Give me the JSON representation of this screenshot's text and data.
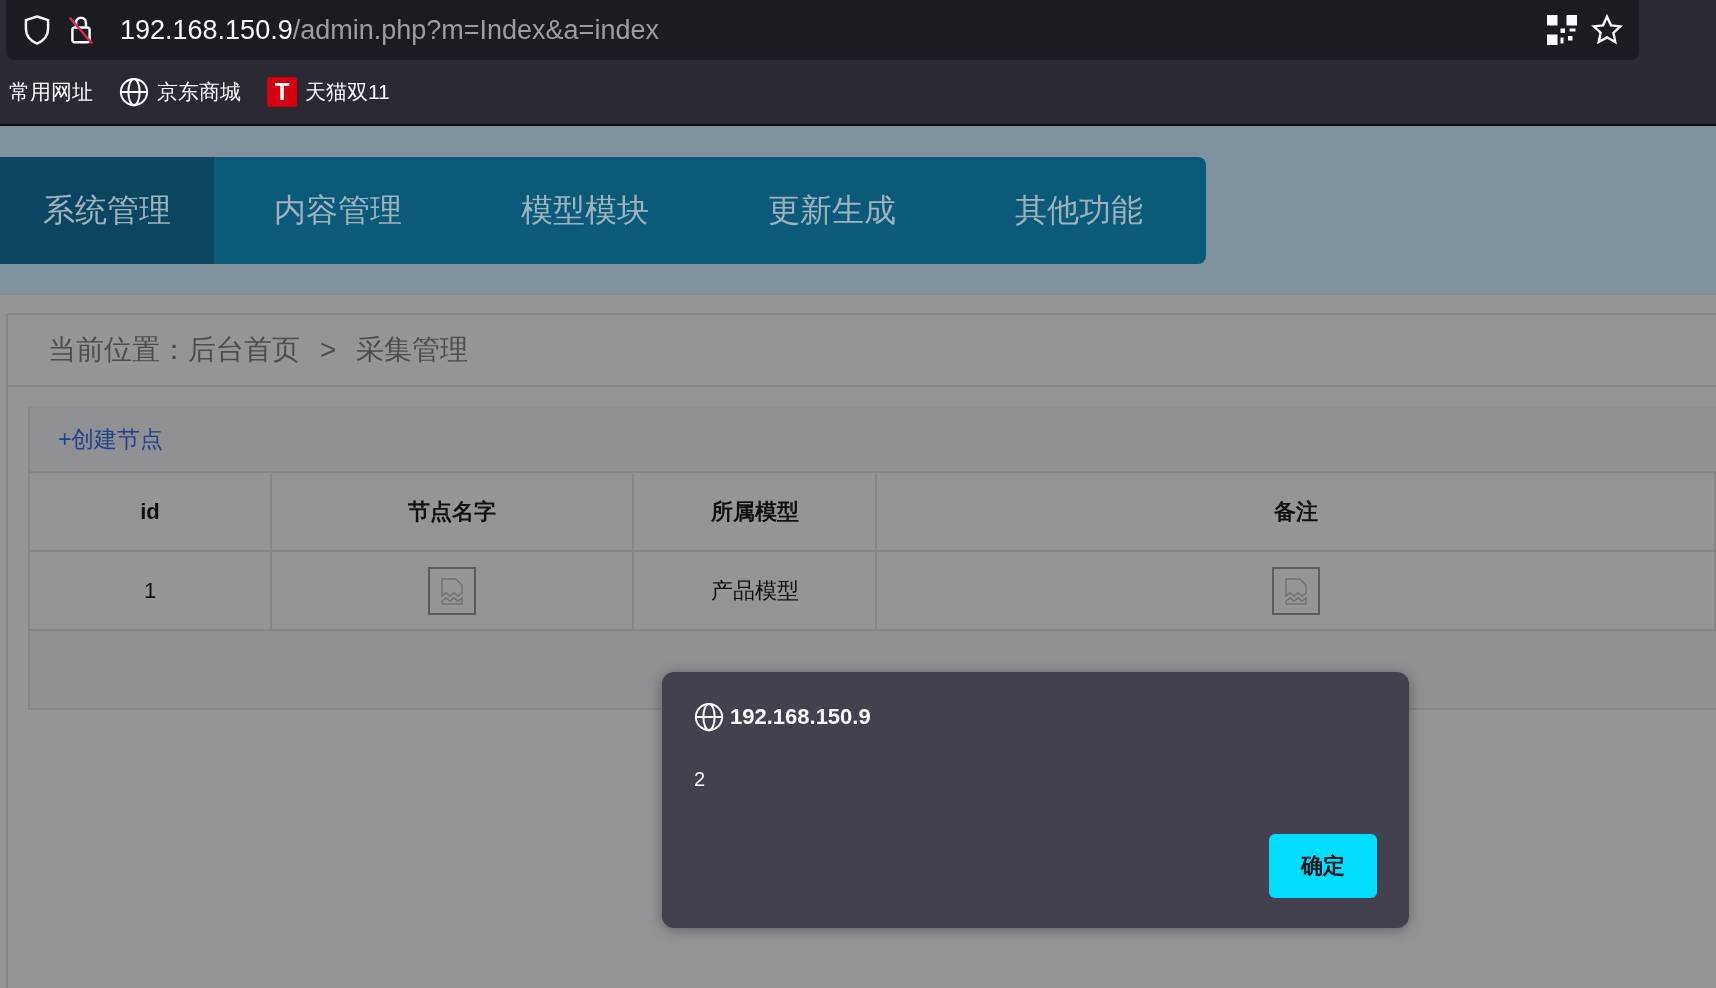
{
  "browser": {
    "url_host": "192.168.150.9",
    "url_path": "/admin.php?m=Index&a=index",
    "bookmarks": [
      {
        "kind": "plain",
        "label": "常用网址"
      },
      {
        "kind": "globe",
        "label": "京东商城"
      },
      {
        "kind": "badge",
        "badge_text": "T",
        "label": "天猫双11"
      }
    ]
  },
  "nav_tabs": [
    {
      "label": "系统管理",
      "selected": true
    },
    {
      "label": "内容管理",
      "selected": false
    },
    {
      "label": "模型模块",
      "selected": false
    },
    {
      "label": "更新生成",
      "selected": false
    },
    {
      "label": "其他功能",
      "selected": false
    }
  ],
  "breadcrumb": {
    "label": "当前位置：",
    "items": [
      "后台首页",
      "采集管理"
    ],
    "separator": ">"
  },
  "create_link": "+创建节点",
  "table": {
    "columns": [
      "id",
      "节点名字",
      "所属模型",
      "备注"
    ],
    "rows": [
      [
        {
          "kind": "text",
          "text": "1"
        },
        {
          "kind": "image"
        },
        {
          "kind": "text",
          "text": "产品模型"
        },
        {
          "kind": "image"
        }
      ]
    ]
  },
  "dialog": {
    "title": "192.168.150.9",
    "message": "2",
    "button": "确定"
  }
}
